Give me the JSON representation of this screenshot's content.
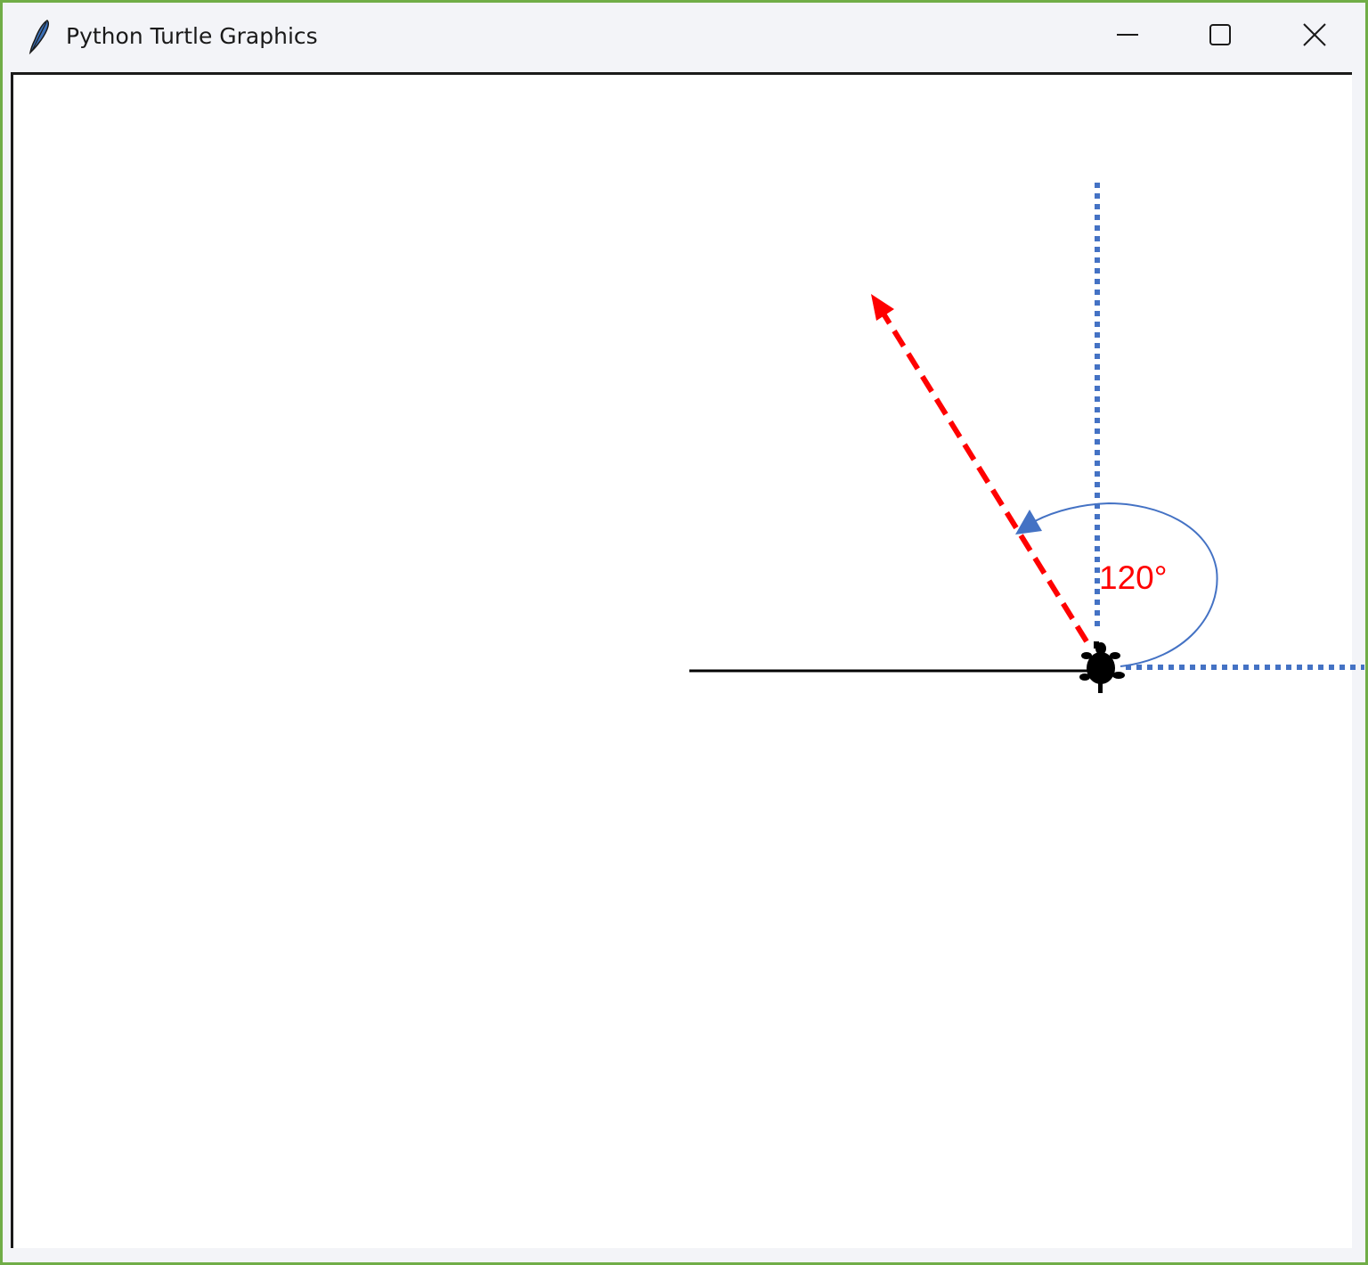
{
  "window": {
    "title": "Python Turtle Graphics",
    "controls": {
      "minimize_icon": "minimize-icon",
      "maximize_icon": "maximize-icon",
      "close_icon": "close-icon"
    }
  },
  "canvas": {
    "annotation": {
      "angle_label": "120°"
    },
    "colors": {
      "heading_arrow": "#ff0000",
      "reference_axes": "#4472c4",
      "turn_arc": "#4472c4",
      "angle_text": "#ff0000",
      "trail_line": "#000000",
      "turtle": "#000000",
      "window_border": "#70ad47"
    }
  }
}
